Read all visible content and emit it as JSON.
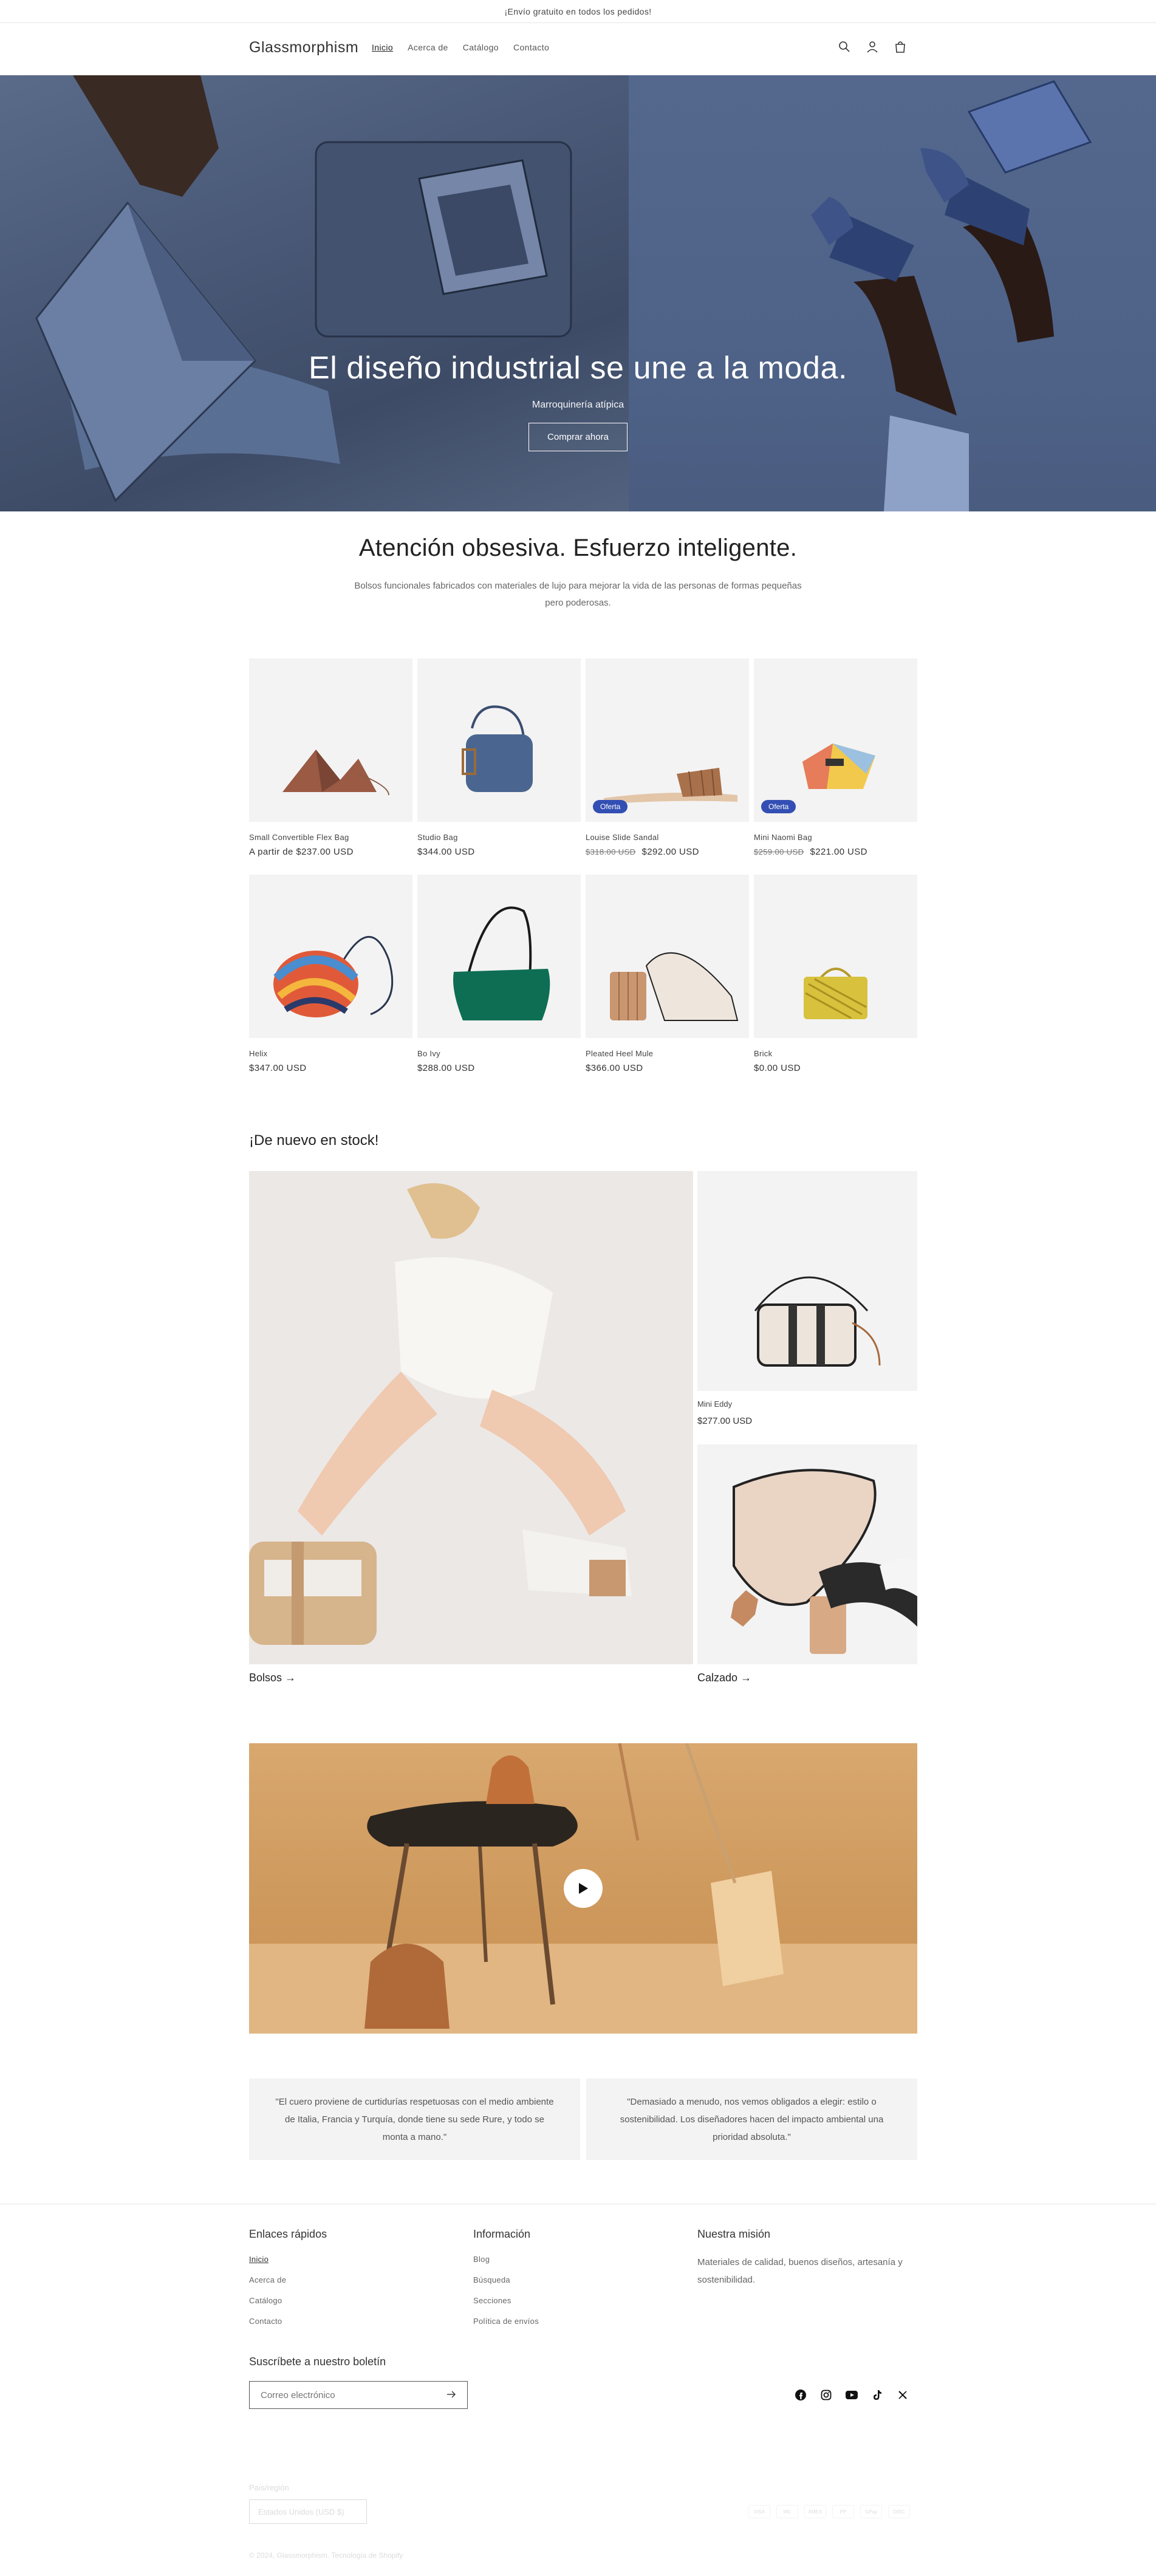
{
  "announcement": "¡Envío gratuito en todos los pedidos!",
  "header": {
    "logo": "Glassmorphism",
    "nav": [
      "Inicio",
      "Acerca de",
      "Catálogo",
      "Contacto"
    ],
    "icons": [
      "search-icon",
      "account-icon",
      "cart-icon"
    ]
  },
  "hero": {
    "title": "El diseño industrial se une a la moda.",
    "subtitle": "Marroquinería atípica",
    "button": "Comprar ahora"
  },
  "intro": {
    "heading": "Atención obsesiva. Esfuerzo inteligente.",
    "text": "Bolsos funcionales fabricados con materiales de lujo para mejorar la vida de las personas de formas pequeñas pero poderosas."
  },
  "products": [
    {
      "title": "Small Convertible Flex Bag",
      "price": "A partir de $237.00 USD",
      "compare": "",
      "badge": ""
    },
    {
      "title": "Studio Bag",
      "price": "$344.00 USD",
      "compare": "",
      "badge": ""
    },
    {
      "title": "Louise Slide Sandal",
      "price": "$292.00 USD",
      "compare": "$318.00 USD",
      "badge": "Oferta"
    },
    {
      "title": "Mini Naomi Bag",
      "price": "$221.00 USD",
      "compare": "$259.00 USD",
      "badge": "Oferta"
    },
    {
      "title": "Helix",
      "price": "$347.00 USD",
      "compare": "",
      "badge": ""
    },
    {
      "title": "Bo Ivy",
      "price": "$288.00 USD",
      "compare": "",
      "badge": ""
    },
    {
      "title": "Pleated Heel Mule",
      "price": "$366.00 USD",
      "compare": "",
      "badge": ""
    },
    {
      "title": "Brick",
      "price": "$0.00 USD",
      "compare": "",
      "badge": ""
    }
  ],
  "collage": {
    "title": "¡De nuevo en stock!",
    "big_link": "Bolsos →",
    "small_title": "Mini Eddy",
    "small_price": "$277.00 USD",
    "small2_link": "Calzado →"
  },
  "quotes": [
    "\"El cuero proviene de curtidurías respetuosas con el medio ambiente de Italia, Francia y Turquía, donde tiene su sede Rure, y todo se monta a mano.\"",
    "\"Demasiado a menudo, nos vemos obligados a elegir: estilo o sostenibilidad. Los diseñadores hacen del impacto ambiental una prioridad absoluta.\""
  ],
  "footer": {
    "col1_title": "Enlaces rápidos",
    "col1_links": [
      "Inicio",
      "Acerca de",
      "Catálogo",
      "Contacto"
    ],
    "col2_title": "Información",
    "col2_links": [
      "Blog",
      "Búsqueda",
      "Secciones",
      "Política de envíos"
    ],
    "col3_title": "Nuestra misión",
    "col3_text": "Materiales de calidad, buenos diseños, artesanía y sostenibilidad.",
    "newsletter_title": "Suscríbete a nuestro boletín",
    "newsletter_placeholder": "Correo electrónico",
    "social": [
      "facebook-icon",
      "instagram-icon",
      "youtube-icon",
      "tiktok-icon",
      "x-icon"
    ],
    "country_label": "País/región",
    "country_value": "Estados Unidos (USD $)",
    "payments": [
      "VISA",
      "MC",
      "AMEX",
      "PP",
      "GPay",
      "DISC"
    ],
    "copyright": "© 2024, Glassmorphism. Tecnología de Shopify"
  }
}
